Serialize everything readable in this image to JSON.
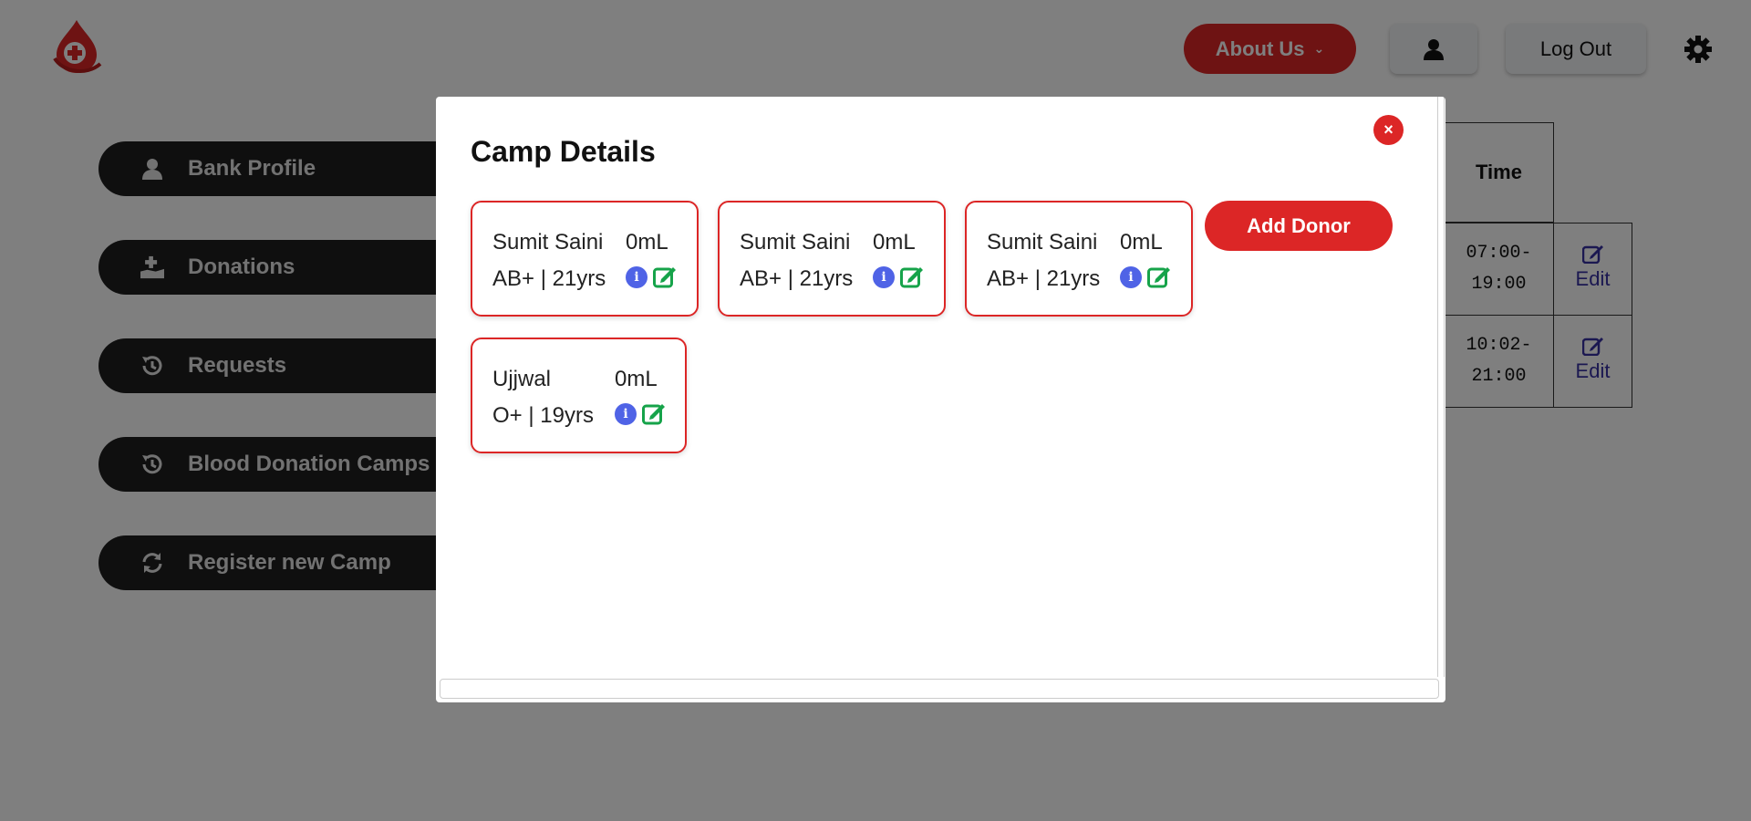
{
  "header": {
    "about_label": "About Us",
    "logout_label": "Log Out"
  },
  "sidebar": {
    "items": [
      {
        "label": "Bank Profile",
        "icon": "user-icon"
      },
      {
        "label": "Donations",
        "icon": "hand-plus-icon"
      },
      {
        "label": "Requests",
        "icon": "history-icon"
      },
      {
        "label": "Blood Donation Camps",
        "icon": "history-icon"
      },
      {
        "label": "Register new Camp",
        "icon": "refresh-icon"
      }
    ]
  },
  "camps_table": {
    "time_header": "Time",
    "rows": [
      {
        "time_start": "07:00-",
        "time_end": "19:00",
        "edit_label": "Edit"
      },
      {
        "time_start": "10:02-",
        "time_end": "21:00",
        "edit_label": "Edit"
      }
    ]
  },
  "modal": {
    "title": "Camp Details",
    "add_donor_label": "Add Donor",
    "close_icon": "×",
    "donors": [
      {
        "name": "Sumit Saini",
        "amount": "0mL",
        "meta": "AB+ | 21yrs"
      },
      {
        "name": "Sumit Saini",
        "amount": "0mL",
        "meta": "AB+ | 21yrs"
      },
      {
        "name": "Sumit Saini",
        "amount": "0mL",
        "meta": "AB+ | 21yrs"
      },
      {
        "name": "Ujjwal",
        "amount": "0mL",
        "meta": "O+ | 19yrs"
      }
    ]
  },
  "colors": {
    "accent": "#dc2626",
    "info": "#4f63e6",
    "edit_green": "#16a34a",
    "edit_link": "#3730a3"
  }
}
